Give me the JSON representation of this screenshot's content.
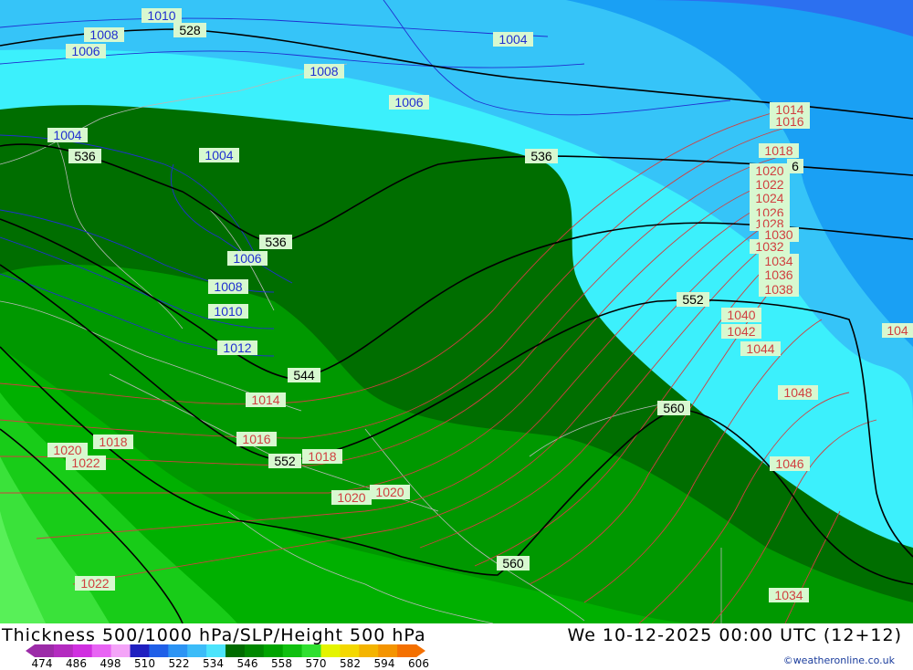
{
  "title": "Thickness 500/1000 hPa/SLP/Height 500 hPa",
  "datetime": "We 10-12-2025 00:00 UTC (12+12)",
  "credit": "©weatheronline.co.uk",
  "colorbar": {
    "ticks": [
      "474",
      "486",
      "498",
      "510",
      "522",
      "534",
      "546",
      "558",
      "570",
      "582",
      "594",
      "606"
    ],
    "colors": [
      "#9c2ca8",
      "#b42cc0",
      "#d030e0",
      "#e864f4",
      "#f4a4f8",
      "#2020c0",
      "#2060e8",
      "#2c94f4",
      "#3cbcf8",
      "#4ce4fc",
      "#006c00",
      "#008800",
      "#00a400",
      "#10c010",
      "#30e030",
      "#e4f400",
      "#f4d800",
      "#f4b400",
      "#f49400",
      "#f47000"
    ]
  },
  "map": {
    "slp_labels_blue": [
      "1010",
      "1008",
      "1006",
      "1004",
      "1008",
      "1006",
      "1004",
      "1004",
      "1006",
      "1008",
      "1010",
      "1012"
    ],
    "slp_labels_red": [
      "1014",
      "1016",
      "1018",
      "1020",
      "1022",
      "1024",
      "1026",
      "1028",
      "1030",
      "1032",
      "1034",
      "1036",
      "1038",
      "1040",
      "1042",
      "1044",
      "1048",
      "1046",
      "1014",
      "1016",
      "1018",
      "1018",
      "1020",
      "1022",
      "1020",
      "1020",
      "1022",
      "1034",
      "1046",
      "104"
    ],
    "height_labels": [
      "528",
      "536",
      "536",
      "536",
      "544",
      "552",
      "552",
      "560",
      "560",
      "536"
    ]
  }
}
